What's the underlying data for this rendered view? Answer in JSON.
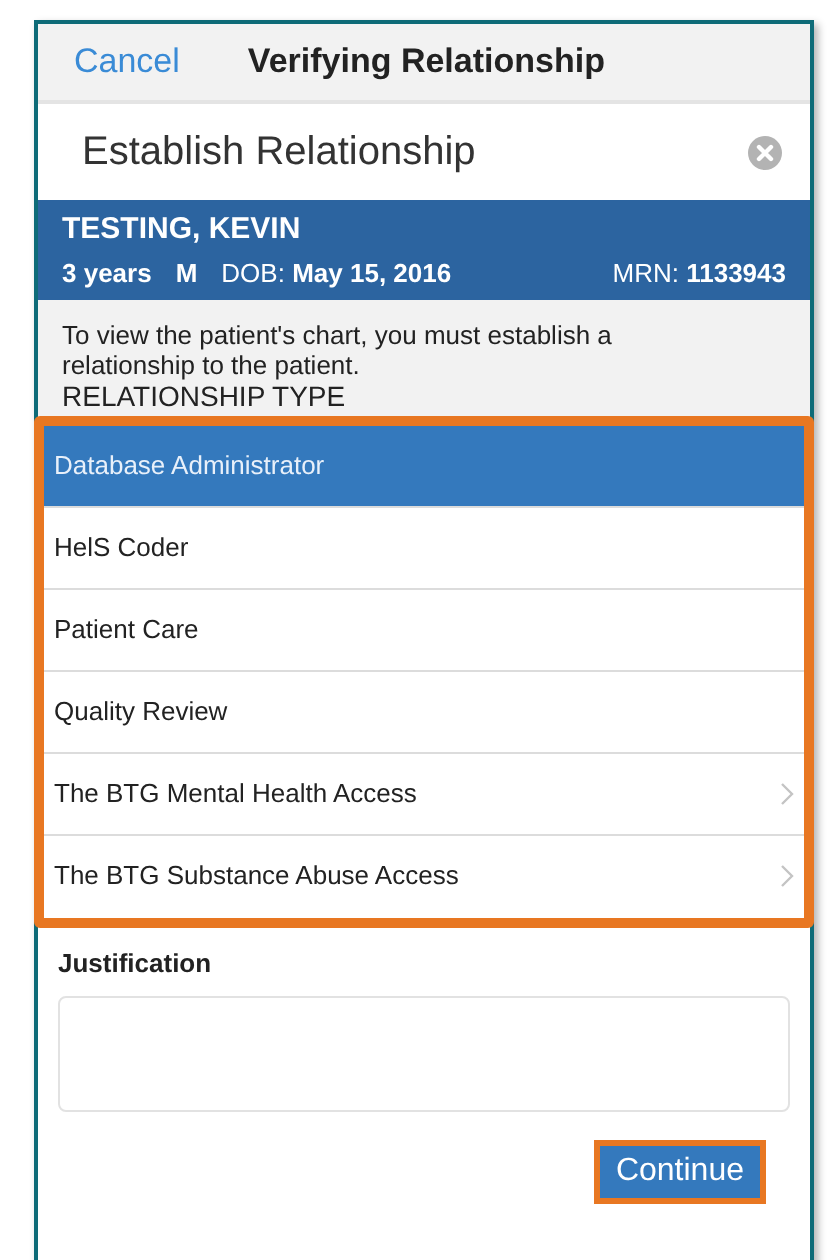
{
  "nav_bar": {
    "cancel": "Cancel",
    "title": "Verifying Relationship"
  },
  "search": {
    "value": "Establish Relationship"
  },
  "patient": {
    "name": "TESTING, KEVIN",
    "age": "3 years",
    "sex": "M",
    "dob": "DOB: **May 15, 2016**",
    "mrn": "MRN: **1133943**"
  },
  "instructions": "To view the patient's chart, you must establish a relationship to the patient.",
  "relationship_type": {
    "heading": "RELATIONSHIP TYPE",
    "highlighted": true,
    "items": [
      {
        "label": "Database Administrator",
        "selected": true,
        "kind": "plain"
      },
      {
        "label": "HelS Coder",
        "selected": false,
        "kind": "plain"
      },
      {
        "label": "Patient Care",
        "selected": false,
        "kind": "plain"
      },
      {
        "label": "Quality Review",
        "selected": false,
        "kind": "plain"
      },
      {
        "label": "The BTG Mental Health Access",
        "selected": false,
        "kind": "disclosure"
      },
      {
        "label": "The BTG Substance Abuse Access",
        "selected": false,
        "kind": "disclosure"
      }
    ]
  },
  "justification": {
    "label": "Justification"
  },
  "continue_button": {
    "label": "Continue",
    "highlighted": true
  }
}
